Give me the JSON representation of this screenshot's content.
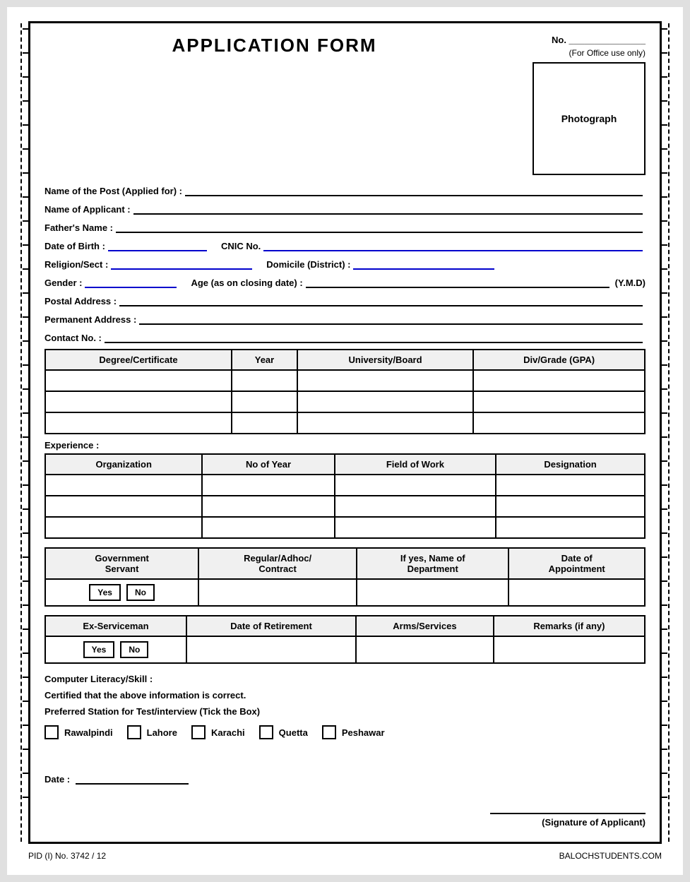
{
  "form": {
    "title": "APPLICATION FORM",
    "office_no_label": "No.",
    "office_use_label": "(For Office use only)",
    "photograph_label": "Photograph",
    "fields": {
      "post_label": "Name of the Post (Applied for) :",
      "applicant_label": "Name of Applicant :",
      "father_label": "Father's Name :",
      "dob_label": "Date of Birth :",
      "cnic_label": "CNIC No.",
      "religion_label": "Religion/Sect :",
      "domicile_label": "Domicile (District) :",
      "gender_label": "Gender :",
      "age_label": "Age (as on closing date) :",
      "ymd_label": "(Y.M.D)",
      "postal_label": "Postal Address :",
      "permanent_label": "Permanent Address :",
      "contact_label": "Contact No. :"
    },
    "education_table": {
      "headers": [
        "Degree/Certificate",
        "Year",
        "University/Board",
        "Div/Grade (GPA)"
      ],
      "rows": [
        [
          "",
          "",
          "",
          ""
        ],
        [
          "",
          "",
          "",
          ""
        ],
        [
          "",
          "",
          "",
          ""
        ]
      ]
    },
    "experience_label": "Experience :",
    "experience_table": {
      "headers": [
        "Organization",
        "No of Year",
        "Field of Work",
        "Designation"
      ],
      "rows": [
        [
          "",
          "",
          "",
          ""
        ],
        [
          "",
          "",
          "",
          ""
        ],
        [
          "",
          "",
          "",
          ""
        ]
      ]
    },
    "govt_table": {
      "headers": [
        "Government\nServant",
        "Regular/Adhoc/\nContract",
        "If yes, Name of\nDepartment",
        "Date of\nAppointment"
      ],
      "yes_label": "Yes",
      "no_label": "No"
    },
    "ex_table": {
      "headers": [
        "Ex-Serviceman",
        "Date of Retirement",
        "Arms/Services",
        "Remarks (if any)"
      ],
      "yes_label": "Yes",
      "no_label": "No"
    },
    "computer_label": "Computer Literacy/Skill :",
    "certified_label": "Certified that the above information is correct.",
    "preferred_station_label": "Preferred Station for Test/interview (Tick the Box)",
    "stations": [
      "Rawalpindi",
      "Lahore",
      "Karachi",
      "Quetta",
      "Peshawar"
    ],
    "date_label": "Date :",
    "signature_label": "(Signature of Applicant)",
    "footer_left": "PID (I) No. 3742 / 12",
    "footer_right": "BALOCHSTUDENTS.COM"
  }
}
